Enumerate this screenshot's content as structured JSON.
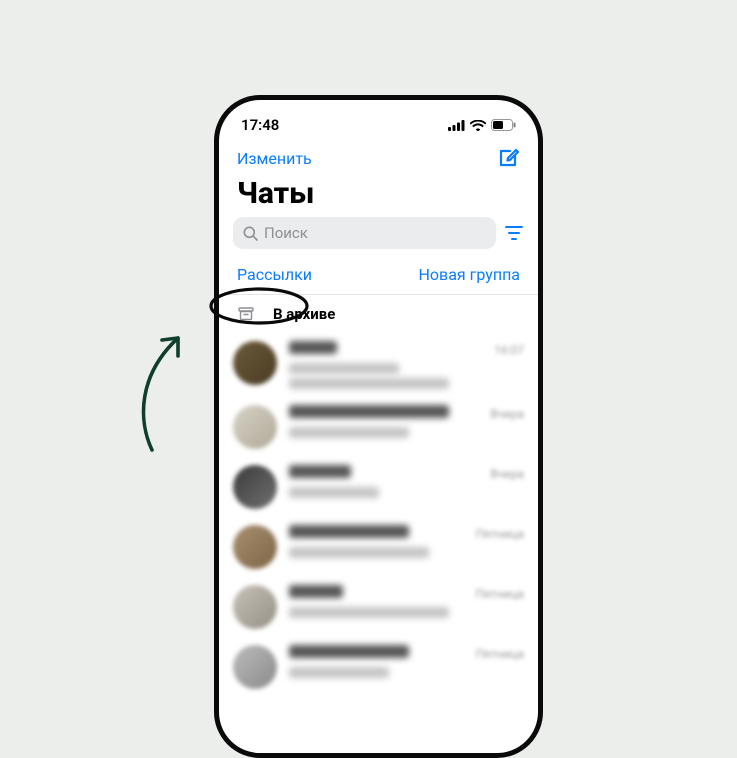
{
  "status_bar": {
    "time": "17:48"
  },
  "header": {
    "edit_label": "Изменить",
    "title": "Чаты"
  },
  "search": {
    "placeholder": "Поиск"
  },
  "link_row": {
    "broadcast_label": "Рассылки",
    "new_group_label": "Новая группа"
  },
  "archive": {
    "label": "В архиве"
  },
  "chats": [
    {
      "time": "16:07",
      "avatar_bg": "linear-gradient(135deg,#6b5a3a,#4a3c24)",
      "name_w": 48,
      "sub1_w": 110,
      "sub2_w": 160
    },
    {
      "time": "Вчера",
      "avatar_bg": "linear-gradient(135deg,#d7d2c8,#b0a997)",
      "name_w": 160,
      "sub1_w": 120,
      "sub2_w": 0
    },
    {
      "time": "Вчера",
      "avatar_bg": "linear-gradient(135deg,#3b3b3b,#707070)",
      "name_w": 62,
      "sub1_w": 90,
      "sub2_w": 0
    },
    {
      "time": "Пятница",
      "avatar_bg": "linear-gradient(135deg,#a98f6f,#7c6547)",
      "name_w": 120,
      "sub1_w": 140,
      "sub2_w": 0
    },
    {
      "time": "Пятница",
      "avatar_bg": "linear-gradient(135deg,#c7c2b8,#959085)",
      "name_w": 54,
      "sub1_w": 160,
      "sub2_w": 0
    },
    {
      "time": "Пятница",
      "avatar_bg": "linear-gradient(135deg,#bcbcbc,#8a8a8a)",
      "name_w": 120,
      "sub1_w": 100,
      "sub2_w": 0
    }
  ],
  "colors": {
    "accent": "#0a7cff",
    "anno": "#0f3e2c"
  }
}
